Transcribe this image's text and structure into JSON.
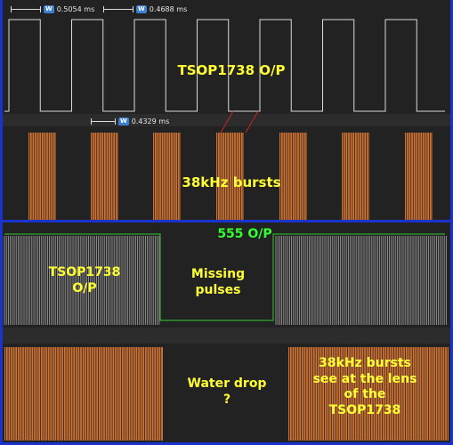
{
  "top": {
    "measurements": [
      {
        "value": "0.5054 ms",
        "badge": "W"
      },
      {
        "value": "0.4688 ms",
        "badge": "W"
      },
      {
        "value": "0.4329 ms",
        "badge": "W"
      }
    ],
    "tsop_label": "TSOP1738 O/P",
    "bursts_label": "38kHz bursts"
  },
  "bottom": {
    "output_label": "555 O/P",
    "tsop_label_line1": "TSOP1738",
    "tsop_label_line2": "O/P",
    "missing_line1": "Missing",
    "missing_line2": "pulses",
    "water_line1": "Water drop",
    "water_line2": "?",
    "bursts_line1": "38kHz bursts",
    "bursts_line2": "see at the lens",
    "bursts_line3": "of the",
    "bursts_line4": "TSOP1738"
  },
  "colors": {
    "frame": "#1a33cc",
    "trace_white": "#d9d9d9",
    "burst_orange": "#c8743a",
    "label_yellow": "#ffff33",
    "label_green": "#33ff33"
  }
}
